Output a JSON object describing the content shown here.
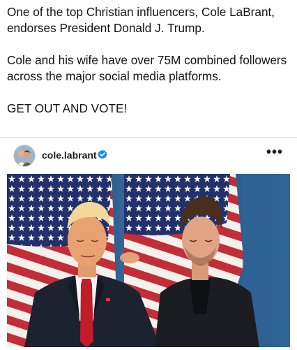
{
  "post": {
    "paragraphs": [
      "One of the top Christian influencers, Cole LaBrant, endorses President Donald J. Trump.",
      "Cole and his wife have over 75M combined followers across the major social media platforms.",
      "GET OUT AND VOTE!"
    ]
  },
  "embed": {
    "username": "cole.labrant",
    "verified_icon": "verified-badge-icon",
    "more_icon": "more-horizontal-icon",
    "more_label": "•••",
    "colors": {
      "verified": "#1d8cf0",
      "curtain": "#2c5a8a",
      "flag_red": "#c02a35",
      "flag_blue": "#1f2f6b"
    }
  }
}
